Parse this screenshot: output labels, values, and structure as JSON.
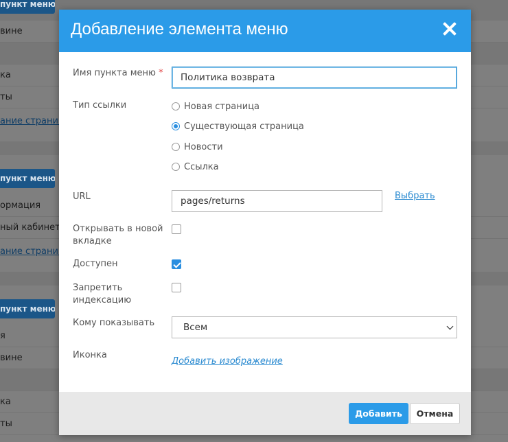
{
  "background": {
    "rows": [
      {
        "kind": "button",
        "label": "пункт меню"
      },
      {
        "kind": "text",
        "label": "вине"
      },
      {
        "kind": "text",
        "label": "ка"
      },
      {
        "kind": "text",
        "label": "ты"
      },
      {
        "kind": "link",
        "label": "ание страниц"
      },
      {
        "kind": "button",
        "label": "пункт меню"
      },
      {
        "kind": "text",
        "label": "ормация"
      },
      {
        "kind": "text",
        "label": "ный кабинет"
      },
      {
        "kind": "link",
        "label": "ание страниц"
      },
      {
        "kind": "button",
        "label": "пункт меню"
      },
      {
        "kind": "text",
        "label": "я"
      },
      {
        "kind": "text",
        "label": "вине"
      },
      {
        "kind": "text",
        "label": "ка"
      },
      {
        "kind": "text",
        "label": "ты"
      }
    ]
  },
  "modal": {
    "title": "Добавление элемента меню",
    "close_icon": "close-icon",
    "fields": {
      "name_label": "Имя пункта меню",
      "name_required_mark": "*",
      "name_value": "Политика возврата",
      "link_type_label": "Тип ссылки",
      "link_types": [
        {
          "label": "Новая страница",
          "checked": false
        },
        {
          "label": "Существующая страница",
          "checked": true
        },
        {
          "label": "Новости",
          "checked": false
        },
        {
          "label": "Ссылка",
          "checked": false
        }
      ],
      "url_label": "URL",
      "url_value": "pages/returns",
      "url_pick_link": "Выбрать",
      "new_tab_label": "Открывать в новой вкладке",
      "new_tab_checked": false,
      "available_label": "Доступен",
      "available_checked": true,
      "noindex_label": "Запретить индексацию",
      "noindex_checked": false,
      "show_to_label": "Кому показывать",
      "show_to_value": "Всем",
      "icon_label": "Иконка",
      "add_image_link": "Добавить изображение"
    },
    "footer": {
      "add_label": "Добавить",
      "cancel_label": "Отмена"
    },
    "colors": {
      "accent": "#2b9be8",
      "required": "#e04040",
      "link": "#2a8ad0"
    }
  }
}
